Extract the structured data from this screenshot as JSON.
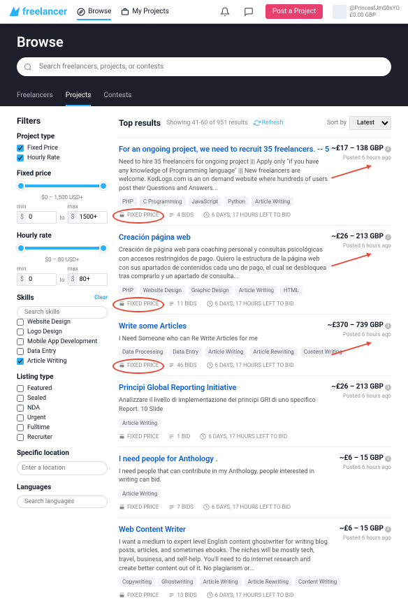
{
  "topbar": {
    "logo": "freelancer",
    "browse": "Browse",
    "myprojects": "My Projects",
    "post": "Post a Project",
    "username": "@PrincesfJmS0sYO",
    "balance": "£0.00 GBP"
  },
  "hero": {
    "title": "Browse",
    "search_placeholder": "Search freelancers, projects, or contests"
  },
  "tabs": {
    "freelancers": "Freelancers",
    "projects": "Projects",
    "contests": "Contests"
  },
  "filters": {
    "title": "Filters",
    "projtype": "Project type",
    "fixed": "Fixed Price",
    "hourly": "Hourly Rate",
    "fixedprice": "Fixed price",
    "fixed_range": "$0 – 1,500 USD+",
    "hourlyrate": "Hourly rate",
    "hourly_range": "$0 – 80 USD+",
    "min": "min",
    "max": "max",
    "min_val": "0",
    "fixed_max_val": "1500+",
    "hourly_max_val": "80+",
    "skills": "Skills",
    "clear": "Clear",
    "skills_placeholder": "Search skills",
    "skill_list": [
      "Website Design",
      "Logo Design",
      "Mobile App Development",
      "Data Entry",
      "Article Writing"
    ],
    "listing": "Listing type",
    "listing_list": [
      "Featured",
      "Sealed",
      "NDA",
      "Urgent",
      "Fulltime",
      "Recruiter"
    ],
    "location": "Specific location",
    "loc_placeholder": "Enter a location",
    "languages": "Languages",
    "lang_placeholder": "Search languages"
  },
  "results": {
    "title": "Top results",
    "count": "Showing 41-60 of 951 results",
    "refresh": "Refresh",
    "sortby": "Sort by",
    "sort_val": "Latest",
    "cards": [
      {
        "title": "For an ongoing project, we need to recruit 35 freelancers. -- 5",
        "price": "~£17 – 138 GBP",
        "posted": "Posted 6 hours ago",
        "desc": "Need to hire 35 freelancers for ongoing project ||| Apply only \"if you have any knowledge of Programming language\" ||| New freelancers are welcome. KodLogs.com is an on demand website where hundreds of users post their Questions and Answers...",
        "tags": [
          "PHP",
          "C Programming",
          "JavaScript",
          "Python",
          "Article Writing"
        ],
        "type": "FIXED PRICE",
        "bids": "4 BIDS",
        "time": "6 DAYS, 17 HOURS LEFT TO BID",
        "circled": true
      },
      {
        "title": "Creación página web",
        "price": "~£26 – 213 GBP",
        "posted": "Posted 6 hours ago",
        "desc": "Creación de página web para coaching personal y consultas psicológicas con accesos restringidos de pago. Quiero la estructura de la página web con sus apartados de contenidos cada uno de pago, el cual se desbloquea tras comprarlo y un apartado de consulta...",
        "tags": [
          "PHP",
          "Website Design",
          "Graphic Design",
          "Article Writing",
          "HTML"
        ],
        "type": "FIXED PRICE",
        "bids": "11 BIDS",
        "time": "6 DAYS, 17 HOURS LEFT TO BID",
        "circled": true
      },
      {
        "title": "Write some Articles",
        "price": "~£370 – 739 GBP",
        "posted": "Posted 6 hours ago",
        "desc": "I Need Someone who can Re Write Articles for me",
        "tags": [
          "Data Processing",
          "Data Entry",
          "Article Writing",
          "Article Rewriting",
          "Content Writing"
        ],
        "type": "FIXED PRICE",
        "bids": "46 BIDS",
        "time": "6 DAYS, 17 HOURS LEFT TO BID",
        "circled": true
      },
      {
        "title": "Principi Global Reporting Initiative",
        "price": "~£26 – 213 GBP",
        "posted": "Posted 6 hours ago",
        "desc": "Analizzare il livello di implementazione dei principi GRI di uno specifico Report. 10 Slide",
        "tags": [
          "Article Writing"
        ],
        "type": "FIXED PRICE",
        "bids": "1 BID",
        "time": "6 DAYS, 17 HOURS LEFT TO BID"
      },
      {
        "title": "I need people for Anthology .",
        "price": "~£6 – 15 GBP",
        "posted": "Posted 6 hours ago",
        "desc": "I need people that can contribute in my Anthology, people interested in writing can bid.",
        "tags": [
          "Article Writing"
        ],
        "type": "FIXED PRICE",
        "bids": "7 BIDS",
        "time": "6 DAYS, 17 HOURS LEFT TO BID"
      },
      {
        "title": "Web Content Writer",
        "price": "~£6 – 15 GBP",
        "posted": "Posted 6 hours ago",
        "desc": "I want a medium to expert level English content ghostwriter for writing blog posts, articles, and sometimes ebooks. The niches will be mostly tech, travel, business, and self-help. You'll need to do internet research and create better content out of it. No plagiarism or...",
        "tags": [
          "Copywriting",
          "Ghostwriting",
          "Article Writing",
          "Article Rewriting",
          "Content Writing"
        ],
        "type": "FIXED PRICE",
        "bids": "13 BIDS",
        "time": "6 DAYS, 17 HOURS LEFT TO BID"
      }
    ]
  }
}
